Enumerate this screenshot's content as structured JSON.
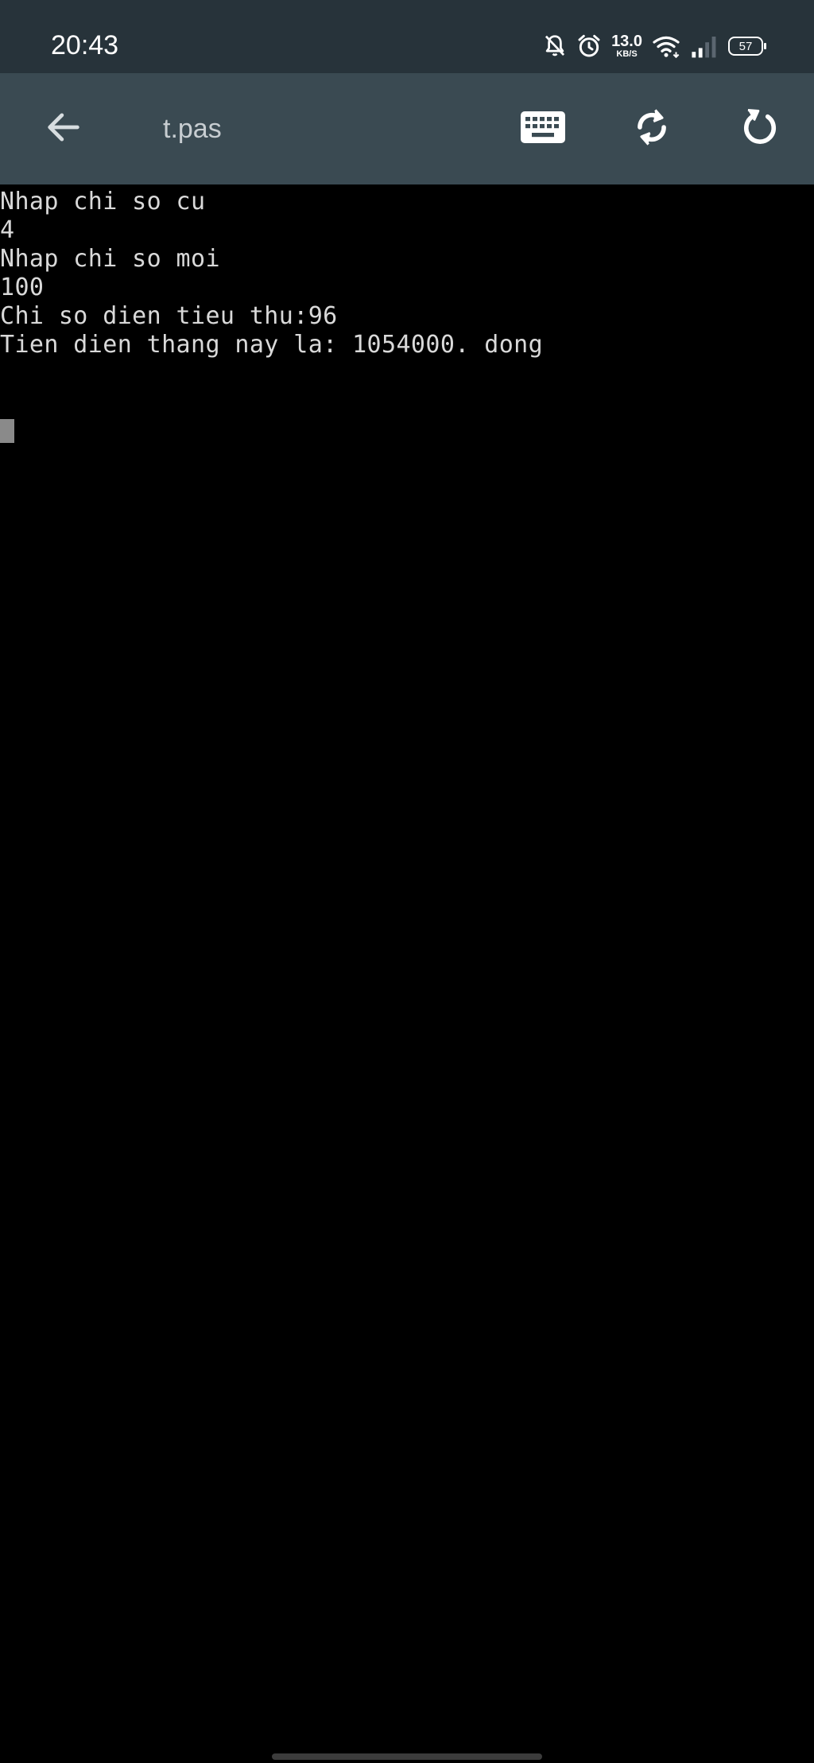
{
  "status_bar": {
    "time": "20:43",
    "net_speed_value": "13.0",
    "net_speed_unit": "KB/S",
    "battery_level": "57",
    "icons": [
      "bell-off-icon",
      "alarm-icon",
      "wifi-icon",
      "signal-icon",
      "battery-icon"
    ]
  },
  "toolbar": {
    "title": "t.pas",
    "icons": [
      "back-arrow-icon",
      "keyboard-icon",
      "sync-icon",
      "refresh-icon"
    ]
  },
  "terminal": {
    "lines": [
      "Nhap chi so cu",
      "4",
      "Nhap chi so moi",
      "100",
      "Chi so dien tieu thu:96",
      "Tien dien thang nay la: 1054000. dong"
    ]
  },
  "colors": {
    "status_bar_bg": "#27333a",
    "toolbar_bg": "#3a4a52",
    "terminal_bg": "#000000",
    "terminal_text": "#d9d9d9"
  }
}
